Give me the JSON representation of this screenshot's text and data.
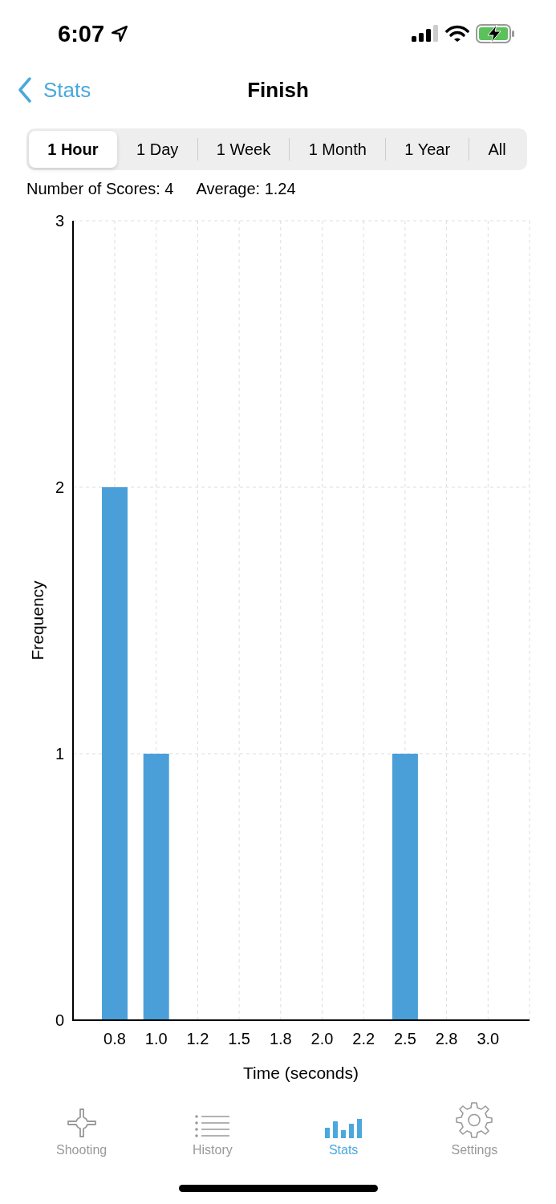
{
  "status_bar": {
    "time": "6:07"
  },
  "nav": {
    "back": "Stats",
    "title": "Finish"
  },
  "ranges": [
    {
      "label": "1 Hour",
      "selected": true
    },
    {
      "label": "1 Day",
      "selected": false
    },
    {
      "label": "1 Week",
      "selected": false
    },
    {
      "label": "1 Month",
      "selected": false
    },
    {
      "label": "1 Year",
      "selected": false
    },
    {
      "label": "All",
      "selected": false
    }
  ],
  "summary": {
    "count": "Number of Scores: 4",
    "average": "Average: 1.24"
  },
  "chart": {
    "chart_data": {
      "type": "bar",
      "xlabel": "Time (seconds)",
      "ylabel": "Frequency",
      "categories": [
        "0.8",
        "1.0",
        "1.2",
        "1.5",
        "1.8",
        "2.0",
        "2.2",
        "2.5",
        "2.8",
        "3.0"
      ],
      "grid": true,
      "series": [
        {
          "color": "#4a9fd9",
          "values": [
            2,
            1,
            0,
            0,
            0,
            0,
            0,
            1,
            0,
            0
          ]
        }
      ],
      "ylim": [
        0,
        3
      ],
      "yticks": [
        0,
        1,
        2,
        3
      ]
    }
  },
  "tab_bar": [
    {
      "kind": "crosshair",
      "label": "Shooting",
      "selected": false
    },
    {
      "kind": "list",
      "label": "History",
      "selected": false
    },
    {
      "kind": "bars",
      "label": "Stats",
      "selected": true
    },
    {
      "kind": "gear",
      "label": "Settings",
      "selected": false
    }
  ]
}
